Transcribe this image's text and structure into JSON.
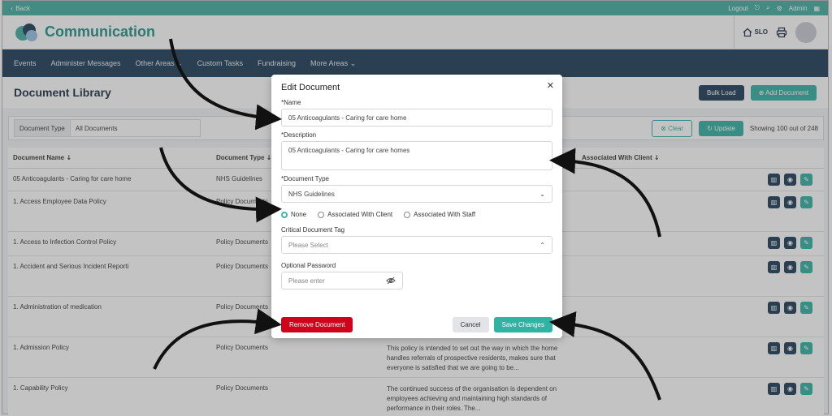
{
  "topbar": {
    "back_label": "Back",
    "logout_label": "Logout",
    "admin_label": "Admin"
  },
  "header": {
    "app_title": "Communication",
    "site_code": "SLO"
  },
  "nav": {
    "items": [
      "Events",
      "Administer Messages",
      "Other Areas",
      "Custom Tasks",
      "Fundraising",
      "More Areas"
    ]
  },
  "page": {
    "title": "Document Library",
    "bulk_load_label": "Bulk Load",
    "add_document_label": "Add Document"
  },
  "filters": {
    "type_label": "Document Type",
    "type_value": "All Documents",
    "clear_label": "Clear",
    "update_label": "Update",
    "showing_text": "Showing 100 out of 248"
  },
  "table": {
    "columns": [
      "Document Name",
      "Document Type",
      "Associated With Client"
    ],
    "rows": [
      {
        "name": "05 Anticoagulants - Caring for care home",
        "type": "NHS Guidelines",
        "desc": ""
      },
      {
        "name": "1. Access Employee Data Policy",
        "type": "Policy Documents",
        "desc": ""
      },
      {
        "name": "1. Access to Infection Control Policy",
        "type": "Policy Documents",
        "desc": ""
      },
      {
        "name": "1. Accident and Serious Incident Reporti",
        "type": "Policy Documents",
        "desc": ""
      },
      {
        "name": "1. Administration of medication",
        "type": "Policy Documents",
        "desc": ""
      },
      {
        "name": "1. Admission Policy",
        "type": "Policy Documents",
        "desc": "This policy is intended to set out the way in which the home handles referrals of prospective residents, makes sure that everyone is satisfied that we are going to be..."
      },
      {
        "name": "1. Capability Policy",
        "type": "Policy Documents",
        "desc": "The continued success of the organisation is dependent on employees achieving and maintaining high standards of performance in their roles. The..."
      }
    ]
  },
  "modal": {
    "title": "Edit Document",
    "name_label": "*Name",
    "name_value": "05 Anticoagulants - Caring for care home",
    "description_label": "*Description",
    "description_value": "05 Anticoagulants - Caring for care homes",
    "doc_type_label": "*Document Type",
    "doc_type_value": "NHS Guidelines",
    "radio_none": "None",
    "radio_client": "Associated With Client",
    "radio_staff": "Associated With Staff",
    "tag_label": "Critical Document Tag",
    "tag_placeholder": "Please Select",
    "password_label": "Optional Password",
    "password_placeholder": "Please enter",
    "remove_label": "Remove Document",
    "cancel_label": "Cancel",
    "save_label": "Save Changes"
  },
  "colors": {
    "teal": "#3fb6a8",
    "navy": "#2c4a63",
    "danger": "#d0021b"
  },
  "icons": [
    "chevron-left-icon",
    "logout-icon",
    "search-icon",
    "gear-icon",
    "grid-icon",
    "home-icon",
    "print-icon",
    "close-icon",
    "chevron-down-icon",
    "chevron-up-icon",
    "eye-off-icon",
    "chart-icon",
    "eye-icon",
    "pencil-icon"
  ]
}
